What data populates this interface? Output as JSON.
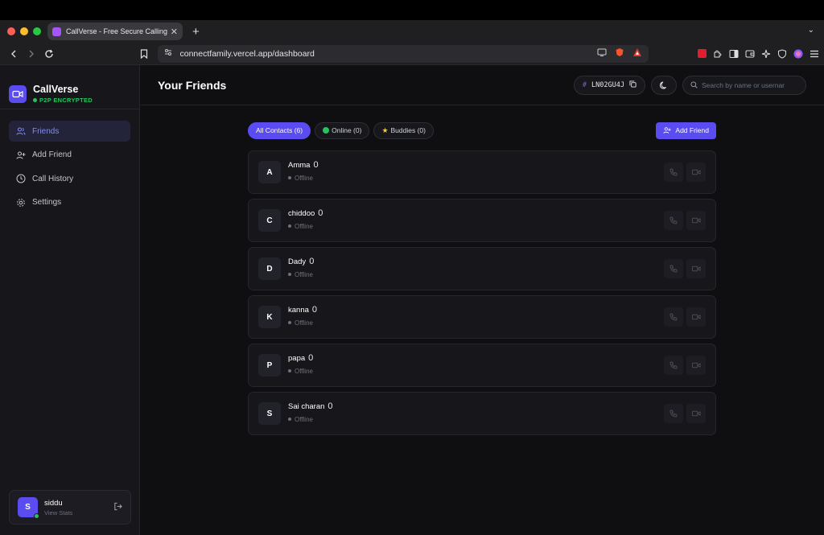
{
  "browser": {
    "tab_title": "CallVerse - Free Secure Calling",
    "url": "connectfamily.vercel.app/dashboard"
  },
  "brand": {
    "name": "CallVerse",
    "subtitle": "P2P ENCRYPTED"
  },
  "sidebar": {
    "items": [
      {
        "label": "Friends",
        "icon": "users-icon",
        "active": true
      },
      {
        "label": "Add Friend",
        "icon": "user-plus-icon",
        "active": false
      },
      {
        "label": "Call History",
        "icon": "clock-icon",
        "active": false
      },
      {
        "label": "Settings",
        "icon": "gear-icon",
        "active": false
      }
    ]
  },
  "user": {
    "initial": "S",
    "name": "siddu",
    "sub": "View Stats"
  },
  "header": {
    "title": "Your Friends",
    "code": "LN02GU4J",
    "search_placeholder": "Search by name or usernar"
  },
  "filters": {
    "all": "All Contacts (6)",
    "online": "Online (0)",
    "buddies": "Buddies (0)",
    "add_friend": "Add Friend"
  },
  "contacts": [
    {
      "initial": "A",
      "name": "Amma",
      "count": "0",
      "status": "Offline"
    },
    {
      "initial": "C",
      "name": "chiddoo",
      "count": "0",
      "status": "Offline"
    },
    {
      "initial": "D",
      "name": "Dady",
      "count": "0",
      "status": "Offline"
    },
    {
      "initial": "K",
      "name": "kanna",
      "count": "0",
      "status": "Offline"
    },
    {
      "initial": "P",
      "name": "papa",
      "count": "0",
      "status": "Offline"
    },
    {
      "initial": "S",
      "name": "Sai charan",
      "count": "0",
      "status": "Offline"
    }
  ],
  "colors": {
    "accent": "#5a4cf0",
    "online": "#22c55e",
    "background": "#0f0f12"
  }
}
